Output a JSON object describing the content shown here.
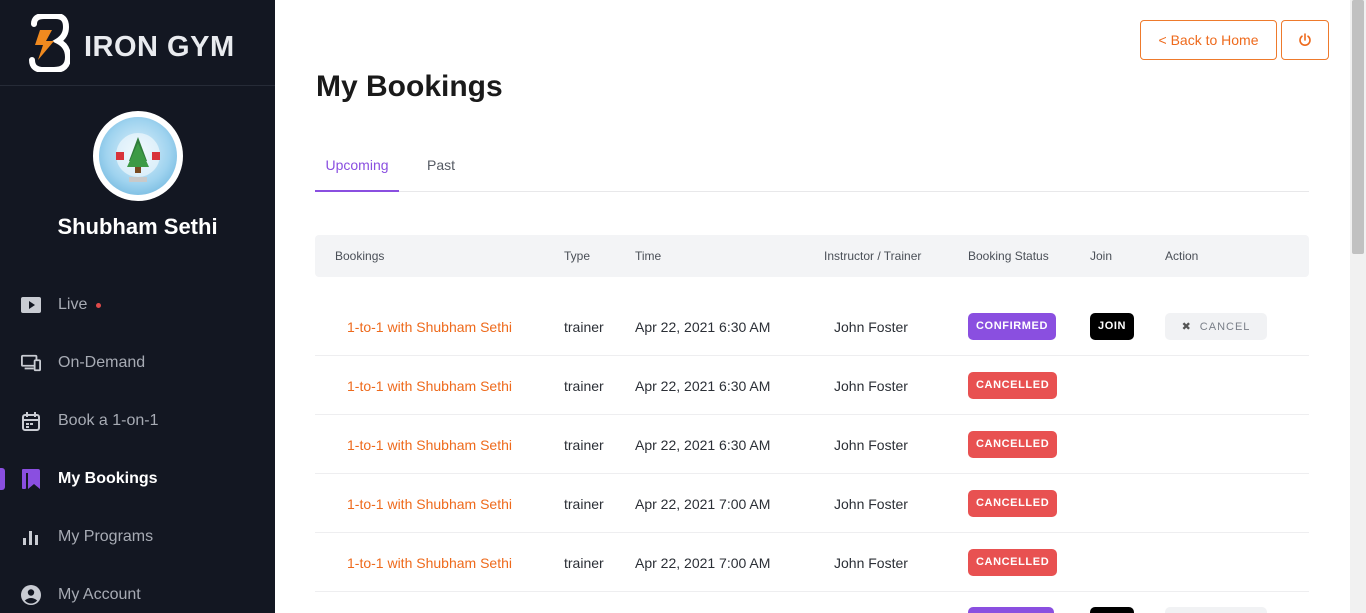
{
  "brand": {
    "name": "IRON GYM",
    "accent": "#ee6a1c"
  },
  "user": {
    "name": "Shubham Sethi"
  },
  "sidebar": {
    "items": [
      {
        "label": "Live",
        "icon": "play-video-icon"
      },
      {
        "label": "On-Demand",
        "icon": "devices-icon"
      },
      {
        "label": "Book a 1-on-1",
        "icon": "calendar-icon"
      },
      {
        "label": "My Bookings",
        "icon": "bookmark-icon",
        "active": true
      },
      {
        "label": "My Programs",
        "icon": "bar-chart-icon"
      },
      {
        "label": "My Account",
        "icon": "account-circle-icon"
      }
    ]
  },
  "header": {
    "back_label": "< Back to Home",
    "power_icon": "power-icon"
  },
  "page": {
    "title": "My Bookings"
  },
  "tabs": [
    {
      "label": "Upcoming",
      "active": true
    },
    {
      "label": "Past"
    }
  ],
  "table": {
    "columns": [
      "Bookings",
      "Type",
      "Time",
      "Instructor / Trainer",
      "Booking Status",
      "Join",
      "Action"
    ],
    "rows": [
      {
        "booking": "1-to-1 with Shubham Sethi",
        "type": "trainer",
        "time": "Apr 22, 2021 6:30 AM",
        "trainer": "John Foster",
        "status": "CONFIRMED",
        "join": "JOIN",
        "action": "CANCEL"
      },
      {
        "booking": "1-to-1 with Shubham Sethi",
        "type": "trainer",
        "time": "Apr 22, 2021 6:30 AM",
        "trainer": "John Foster",
        "status": "CANCELLED"
      },
      {
        "booking": "1-to-1 with Shubham Sethi",
        "type": "trainer",
        "time": "Apr 22, 2021 6:30 AM",
        "trainer": "John Foster",
        "status": "CANCELLED"
      },
      {
        "booking": "1-to-1 with Shubham Sethi",
        "type": "trainer",
        "time": "Apr 22, 2021 7:00 AM",
        "trainer": "John Foster",
        "status": "CANCELLED"
      },
      {
        "booking": "1-to-1 with Shubham Sethi",
        "type": "trainer",
        "time": "Apr 22, 2021 7:00 AM",
        "trainer": "John Foster",
        "status": "CANCELLED"
      }
    ]
  },
  "colors": {
    "confirmed": "#8a4fe0",
    "cancelled": "#e85151",
    "sidebar_bg": "#131722"
  }
}
